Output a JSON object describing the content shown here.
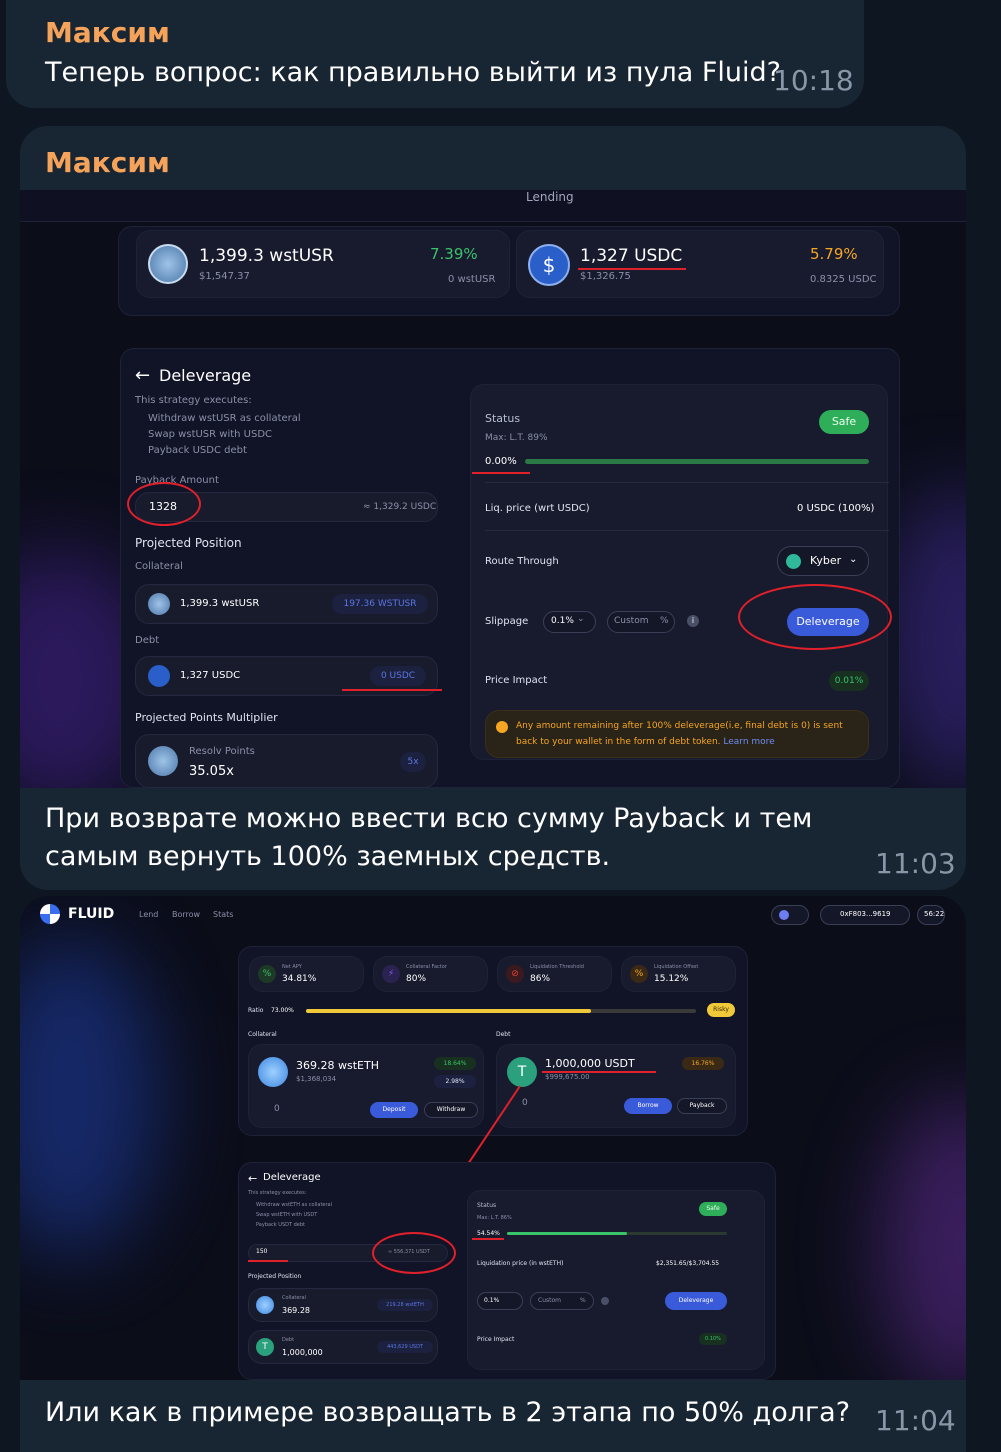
{
  "messages": [
    {
      "sender": "Максим",
      "text": "Теперь вопрос: как правильно выйти из пула Fluid?",
      "time": "10:18"
    },
    {
      "sender": "Максим",
      "text": "При возврате можно ввести всю сумму Payback и тем самым вернуть 100% заемных средств.",
      "time": "11:03"
    },
    {
      "text": "Или как в примере возвращать в 2 этапа по 50% долга?",
      "time": "11:04"
    }
  ],
  "shot1": {
    "nav_partial": "Lending",
    "supply": {
      "amount": "1,399.3 wstUSR",
      "usd": "$1,547.37",
      "apy": "7.39%",
      "sub": "0 wstUSR"
    },
    "borrow": {
      "amount": "1,327 USDC",
      "usd": "$1,326.75",
      "apy": "5.79%",
      "sub": "0.8325 USDC"
    },
    "deleverage": {
      "title": "Deleverage",
      "executes_label": "This strategy executes:",
      "steps": [
        "Withdraw wstUSR as collateral",
        "Swap wstUSR with USDC",
        "Payback USDC debt"
      ],
      "payback_label": "Payback Amount",
      "payback_value": "1328",
      "payback_approx": "≈ 1,329.2 USDC",
      "projected_label": "Projected Position",
      "collateral_label": "Collateral",
      "collateral_value": "1,399.3 wstUSR",
      "collateral_badge": "197.36 WSTUSR",
      "debt_label": "Debt",
      "debt_value": "1,327 USDC",
      "debt_badge": "0 USDC",
      "points_label": "Projected Points Multiplier",
      "points_name": "Resolv Points",
      "points_value": "35.05x",
      "points_badge": "5x"
    },
    "status": {
      "label": "Status",
      "badge": "Safe",
      "max_lt": "Max: L.T. 89%",
      "ratio": "0.00%",
      "ratio_fraction": 0.0,
      "liq_label": "Liq. price (wrt USDC)",
      "liq_value": "0 USDC",
      "liq_pct": "(100%)",
      "route_label": "Route Through",
      "route_value": "Kyber",
      "slippage_label": "Slippage",
      "slippage_value": "0.1%",
      "custom_label": "Custom",
      "custom_unit": "%",
      "deleverage_btn": "Deleverage",
      "impact_label": "Price Impact",
      "impact_value": "0.01%",
      "note": "Any amount remaining after 100% deleverage(i.e, final debt is 0) is sent back to your wallet in the form of debt token.",
      "note_link": "Learn more"
    }
  },
  "shot2": {
    "brand": "FLUID",
    "nav": [
      "Lend",
      "Borrow",
      "Stats"
    ],
    "wallet": "0xF803...9619",
    "clock": "56:22",
    "stats": [
      {
        "label": "Net APY",
        "value": "34.81%",
        "icon": "percent-icon",
        "color": "#39c36a"
      },
      {
        "label": "Collateral Factor",
        "value": "80%",
        "icon": "bolt-icon",
        "color": "#8b5cf6"
      },
      {
        "label": "Liquidation Threshold",
        "value": "86%",
        "icon": "stop-icon",
        "color": "#e0443a"
      },
      {
        "label": "Liquidation Offset",
        "value": "15.12%",
        "icon": "percent-icon",
        "color": "#f5a623"
      }
    ],
    "ratio_label": "Ratio",
    "ratio_value": "73.00%",
    "ratio_fraction": 0.73,
    "risk_badge": "Risky",
    "collateral": {
      "label": "Collateral",
      "amount": "369.28 wstETH",
      "usd": "$1,368,034",
      "apy1": "18.64%",
      "apy2": "2.98%",
      "sub": "0",
      "btn1": "Deposit",
      "btn2": "Withdraw"
    },
    "debt": {
      "label": "Debt",
      "amount": "1,000,000 USDT",
      "usd": "$999,675.00",
      "apy": "16.76%",
      "sub": "0",
      "btn1": "Borrow",
      "btn2": "Payback"
    },
    "deleverage": {
      "title": "Deleverage",
      "executes_label": "This strategy executes:",
      "steps": [
        "Withdraw wstETH as collateral",
        "Swap wstETH with USDT",
        "Payback USDT debt"
      ],
      "payback_value": "150",
      "payback_approx": "≈ 556,371 USDT",
      "projected_label": "Projected Position",
      "collateral_label": "Collateral",
      "collateral_value": "369.28",
      "collateral_badge": "219.28 wstETH",
      "debt_label": "Debt",
      "debt_value": "1,000,000",
      "debt_badge": "443,629 USDT"
    },
    "status": {
      "label": "Status",
      "badge": "Safe",
      "max_lt": "Max: L.T. 86%",
      "ratio": "54.54%",
      "ratio_fraction": 0.5454,
      "liq_label": "Liquidation price (in wstETH)",
      "liq_value": "$2,351.65/$3,704.55",
      "slippage_value": "0.1%",
      "custom_label": "Custom",
      "custom_unit": "%",
      "deleverage_btn": "Deleverage",
      "impact_label": "Price Impact",
      "impact_value": "0.10%"
    }
  }
}
